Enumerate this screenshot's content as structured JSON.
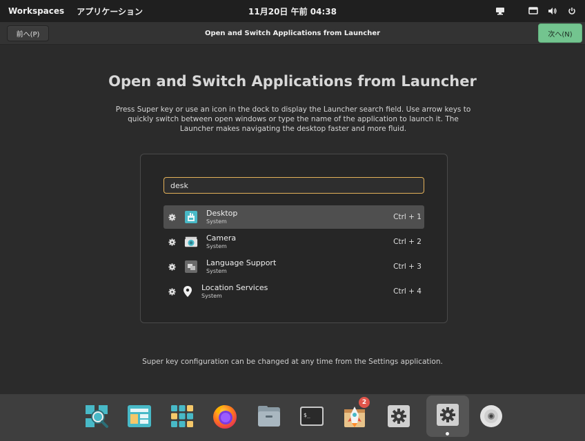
{
  "top_panel": {
    "workspaces": "Workspaces",
    "applications": "アプリケーション",
    "clock": "11月20日 午前 04:38"
  },
  "header": {
    "prev_label": "前へ(P)",
    "title": "Open and Switch Applications from Launcher",
    "next_label": "次へ(N)"
  },
  "main": {
    "title": "Open and Switch Applications from Launcher",
    "description": "Press Super key or use an icon in the dock to display the Launcher search field. Use arrow keys to quickly switch between open windows or type the name of the application to launch it. The Launcher makes navigating the desktop faster and more fluid.",
    "footer_note": "Super key configuration can be changed at any time from the Settings application."
  },
  "launcher": {
    "search_value": "desk",
    "results": [
      {
        "name": "Desktop",
        "subtitle": "System",
        "shortcut": "Ctrl + 1",
        "icon": "desktop-settings-icon",
        "selected": true
      },
      {
        "name": "Camera",
        "subtitle": "System",
        "shortcut": "Ctrl + 2",
        "icon": "camera-icon",
        "selected": false
      },
      {
        "name": "Language Support",
        "subtitle": "System",
        "shortcut": "Ctrl + 3",
        "icon": "language-support-icon",
        "selected": false
      },
      {
        "name": "Location Services",
        "subtitle": "System",
        "shortcut": "Ctrl + 4",
        "icon": "location-pin-icon",
        "selected": false
      }
    ]
  },
  "dock": {
    "items": [
      {
        "name": "launcher-search",
        "icon": "search-magnifier-icon"
      },
      {
        "name": "workspaces",
        "icon": "workspaces-icon"
      },
      {
        "name": "app-library",
        "icon": "app-grid-icon"
      },
      {
        "name": "firefox",
        "icon": "firefox-icon"
      },
      {
        "name": "files",
        "icon": "files-icon"
      },
      {
        "name": "terminal",
        "icon": "terminal-icon"
      },
      {
        "name": "pop-shop",
        "icon": "shop-rocket-icon",
        "badge": "2"
      },
      {
        "name": "settings",
        "icon": "settings-gear-icon"
      },
      {
        "name": "settings-active",
        "icon": "settings-gear-icon",
        "active": true
      },
      {
        "name": "disks",
        "icon": "disc-icon"
      }
    ]
  },
  "colors": {
    "accent_next": "#73c48f",
    "search_border": "#e5b25a",
    "badge": "#e0554b"
  }
}
